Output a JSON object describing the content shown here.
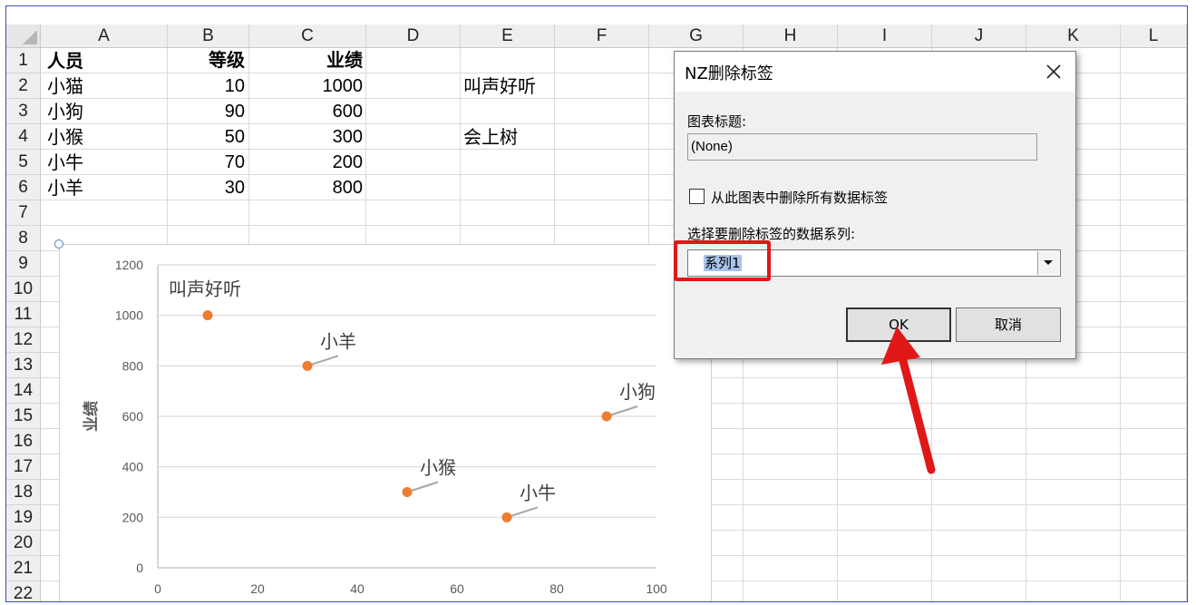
{
  "spreadsheet": {
    "columns": [
      "A",
      "B",
      "C",
      "D",
      "E",
      "F",
      "G",
      "H",
      "I",
      "J",
      "K",
      "L"
    ],
    "rows": [
      "1",
      "2",
      "3",
      "4",
      "5",
      "6",
      "7",
      "8",
      "9",
      "10",
      "11",
      "12",
      "13",
      "14",
      "15",
      "16",
      "17",
      "18",
      "19",
      "20",
      "21",
      "22"
    ],
    "header": {
      "a": "人员",
      "b": "等级",
      "c": "业绩"
    },
    "data": [
      {
        "a": "小猫",
        "b": "10",
        "c": "1000"
      },
      {
        "a": "小狗",
        "b": "90",
        "c": "600"
      },
      {
        "a": "小猴",
        "b": "50",
        "c": "300"
      },
      {
        "a": "小牛",
        "b": "70",
        "c": "200"
      },
      {
        "a": "小羊",
        "b": "30",
        "c": "800"
      }
    ],
    "e2": "叫声好听",
    "e4": "会上树"
  },
  "chart_data": {
    "type": "scatter",
    "ylabel": "业绩",
    "xlabel": "",
    "xlim": [
      0,
      100
    ],
    "ylim": [
      0,
      1200
    ],
    "xticks": [
      "0",
      "20",
      "40",
      "60",
      "80",
      "100"
    ],
    "yticks": [
      "0",
      "200",
      "400",
      "600",
      "800",
      "1000",
      "1200"
    ],
    "grid": true,
    "marker_color": "#ED7D31",
    "points": [
      {
        "x": 10,
        "y": 1000,
        "label": "叫声好听"
      },
      {
        "x": 90,
        "y": 600,
        "label": "小狗"
      },
      {
        "x": 50,
        "y": 300,
        "label": "小猴"
      },
      {
        "x": 70,
        "y": 200,
        "label": "小牛"
      },
      {
        "x": 30,
        "y": 800,
        "label": "小羊"
      }
    ]
  },
  "dialog": {
    "title": "NZ删除标签",
    "chart_title_label": "图表标题:",
    "chart_title_value": "(None)",
    "checkbox_label": "从此图表中删除所有数据标签",
    "checkbox_checked": false,
    "series_label": "选择要删除标签的数据系列:",
    "series_value": "系列1",
    "ok_label": "OK",
    "cancel_label": "取消"
  },
  "colors": {
    "annotation": "#e01818",
    "marker": "#ED7D31"
  }
}
